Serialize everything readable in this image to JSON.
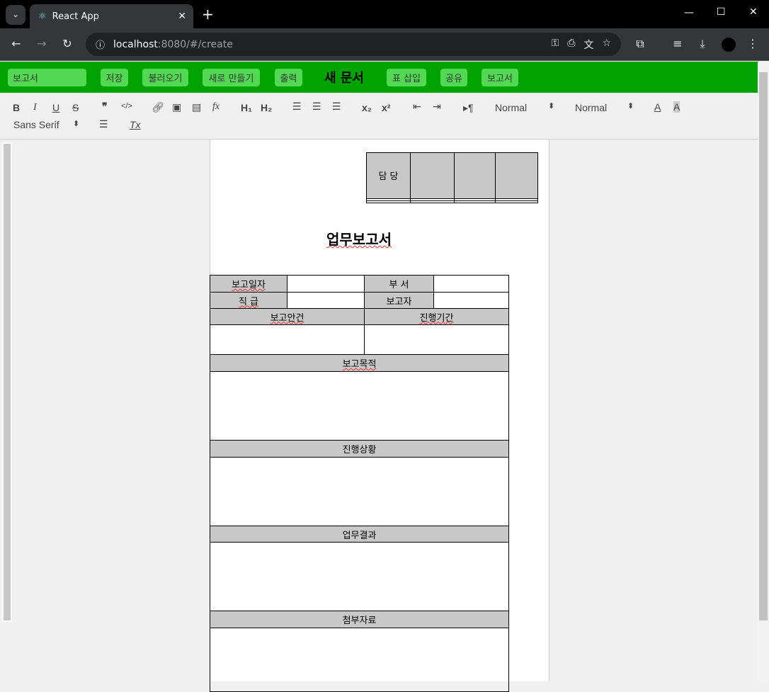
{
  "browser": {
    "tab_title": "React App",
    "url_host": "localhost",
    "url_rest": ":8080/#/create"
  },
  "appbar": {
    "doc_name": "보고서",
    "buttons": [
      "저장",
      "불러오기",
      "새로 만들기",
      "출력"
    ],
    "heading": "새 문서",
    "buttons2": [
      "표 삽입",
      "공유",
      "보고서"
    ],
    "accent": "#00a300"
  },
  "editor_toolbar": {
    "header_select": "Normal",
    "size_select": "Normal",
    "font_select": "Sans Serif"
  },
  "approval": {
    "label": "담 당"
  },
  "doc": {
    "title": "업무보고서",
    "labels": {
      "date": "보고일자",
      "dept": "부 서",
      "rank": "직 급",
      "reporter": "보고자",
      "subject": "보고안건",
      "period": "진행기간",
      "purpose": "보고목적",
      "status": "진행상황",
      "result": "업무결과",
      "attach": "첨부자료"
    }
  }
}
